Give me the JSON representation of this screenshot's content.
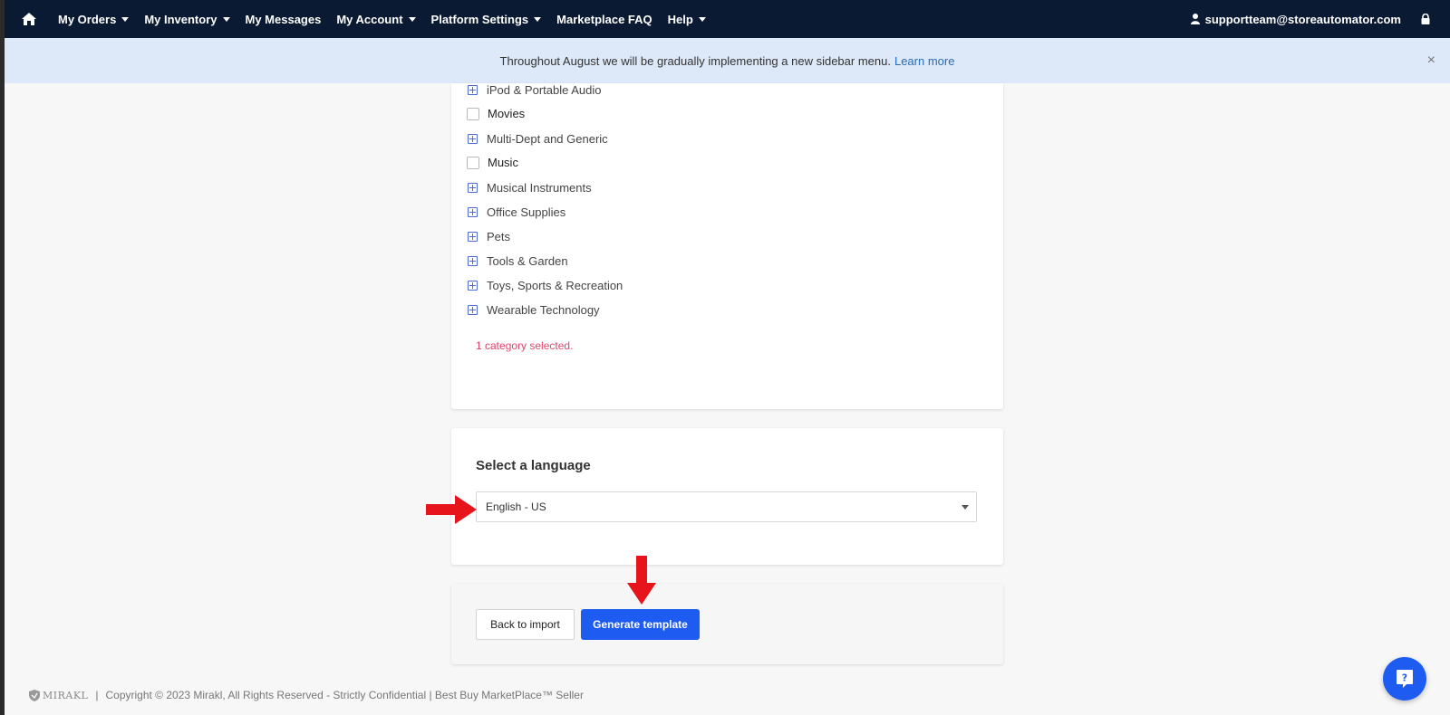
{
  "nav": {
    "items": [
      {
        "label": "My Orders",
        "has_caret": true
      },
      {
        "label": "My Inventory",
        "has_caret": true
      },
      {
        "label": "My Messages",
        "has_caret": false
      },
      {
        "label": "My Account",
        "has_caret": true
      },
      {
        "label": "Platform Settings",
        "has_caret": true
      },
      {
        "label": "Marketplace FAQ",
        "has_caret": false
      },
      {
        "label": "Help",
        "has_caret": true
      }
    ],
    "user_email": "supportteam@storeautomator.com",
    "home_icon": "home-icon",
    "user_icon": "user-icon",
    "lock_icon": "lock-icon"
  },
  "banner": {
    "message": "Throughout August we will be gradually implementing a new sidebar menu.",
    "link": "Learn more",
    "close": "×"
  },
  "categories": {
    "items": [
      {
        "label": "iPod & Portable Audio",
        "kind": "expand"
      },
      {
        "label": "Movies",
        "kind": "checkbox"
      },
      {
        "label": "Multi-Dept and Generic",
        "kind": "expand"
      },
      {
        "label": "Music",
        "kind": "checkbox"
      },
      {
        "label": "Musical Instruments",
        "kind": "expand"
      },
      {
        "label": "Office Supplies",
        "kind": "expand"
      },
      {
        "label": "Pets",
        "kind": "expand"
      },
      {
        "label": "Tools & Garden",
        "kind": "expand"
      },
      {
        "label": "Toys, Sports & Recreation",
        "kind": "expand"
      },
      {
        "label": "Wearable Technology",
        "kind": "expand"
      }
    ],
    "selected_note": "1 category selected."
  },
  "language": {
    "title": "Select a language",
    "selected": "English - US"
  },
  "actions": {
    "back_label": "Back to import",
    "generate_label": "Generate template"
  },
  "footer": {
    "logo_text": "MIRAKL",
    "separator": "|",
    "copyright": "Copyright © 2023 Mirakl, All Rights Reserved - Strictly Confidential | Best Buy MarketPlace™ Seller"
  },
  "colors": {
    "nav_bg": "#0b1a33",
    "banner_bg": "#dde9f9",
    "primary": "#1e5bf0",
    "note": "#e0446a",
    "annotation": "#e8141c"
  }
}
